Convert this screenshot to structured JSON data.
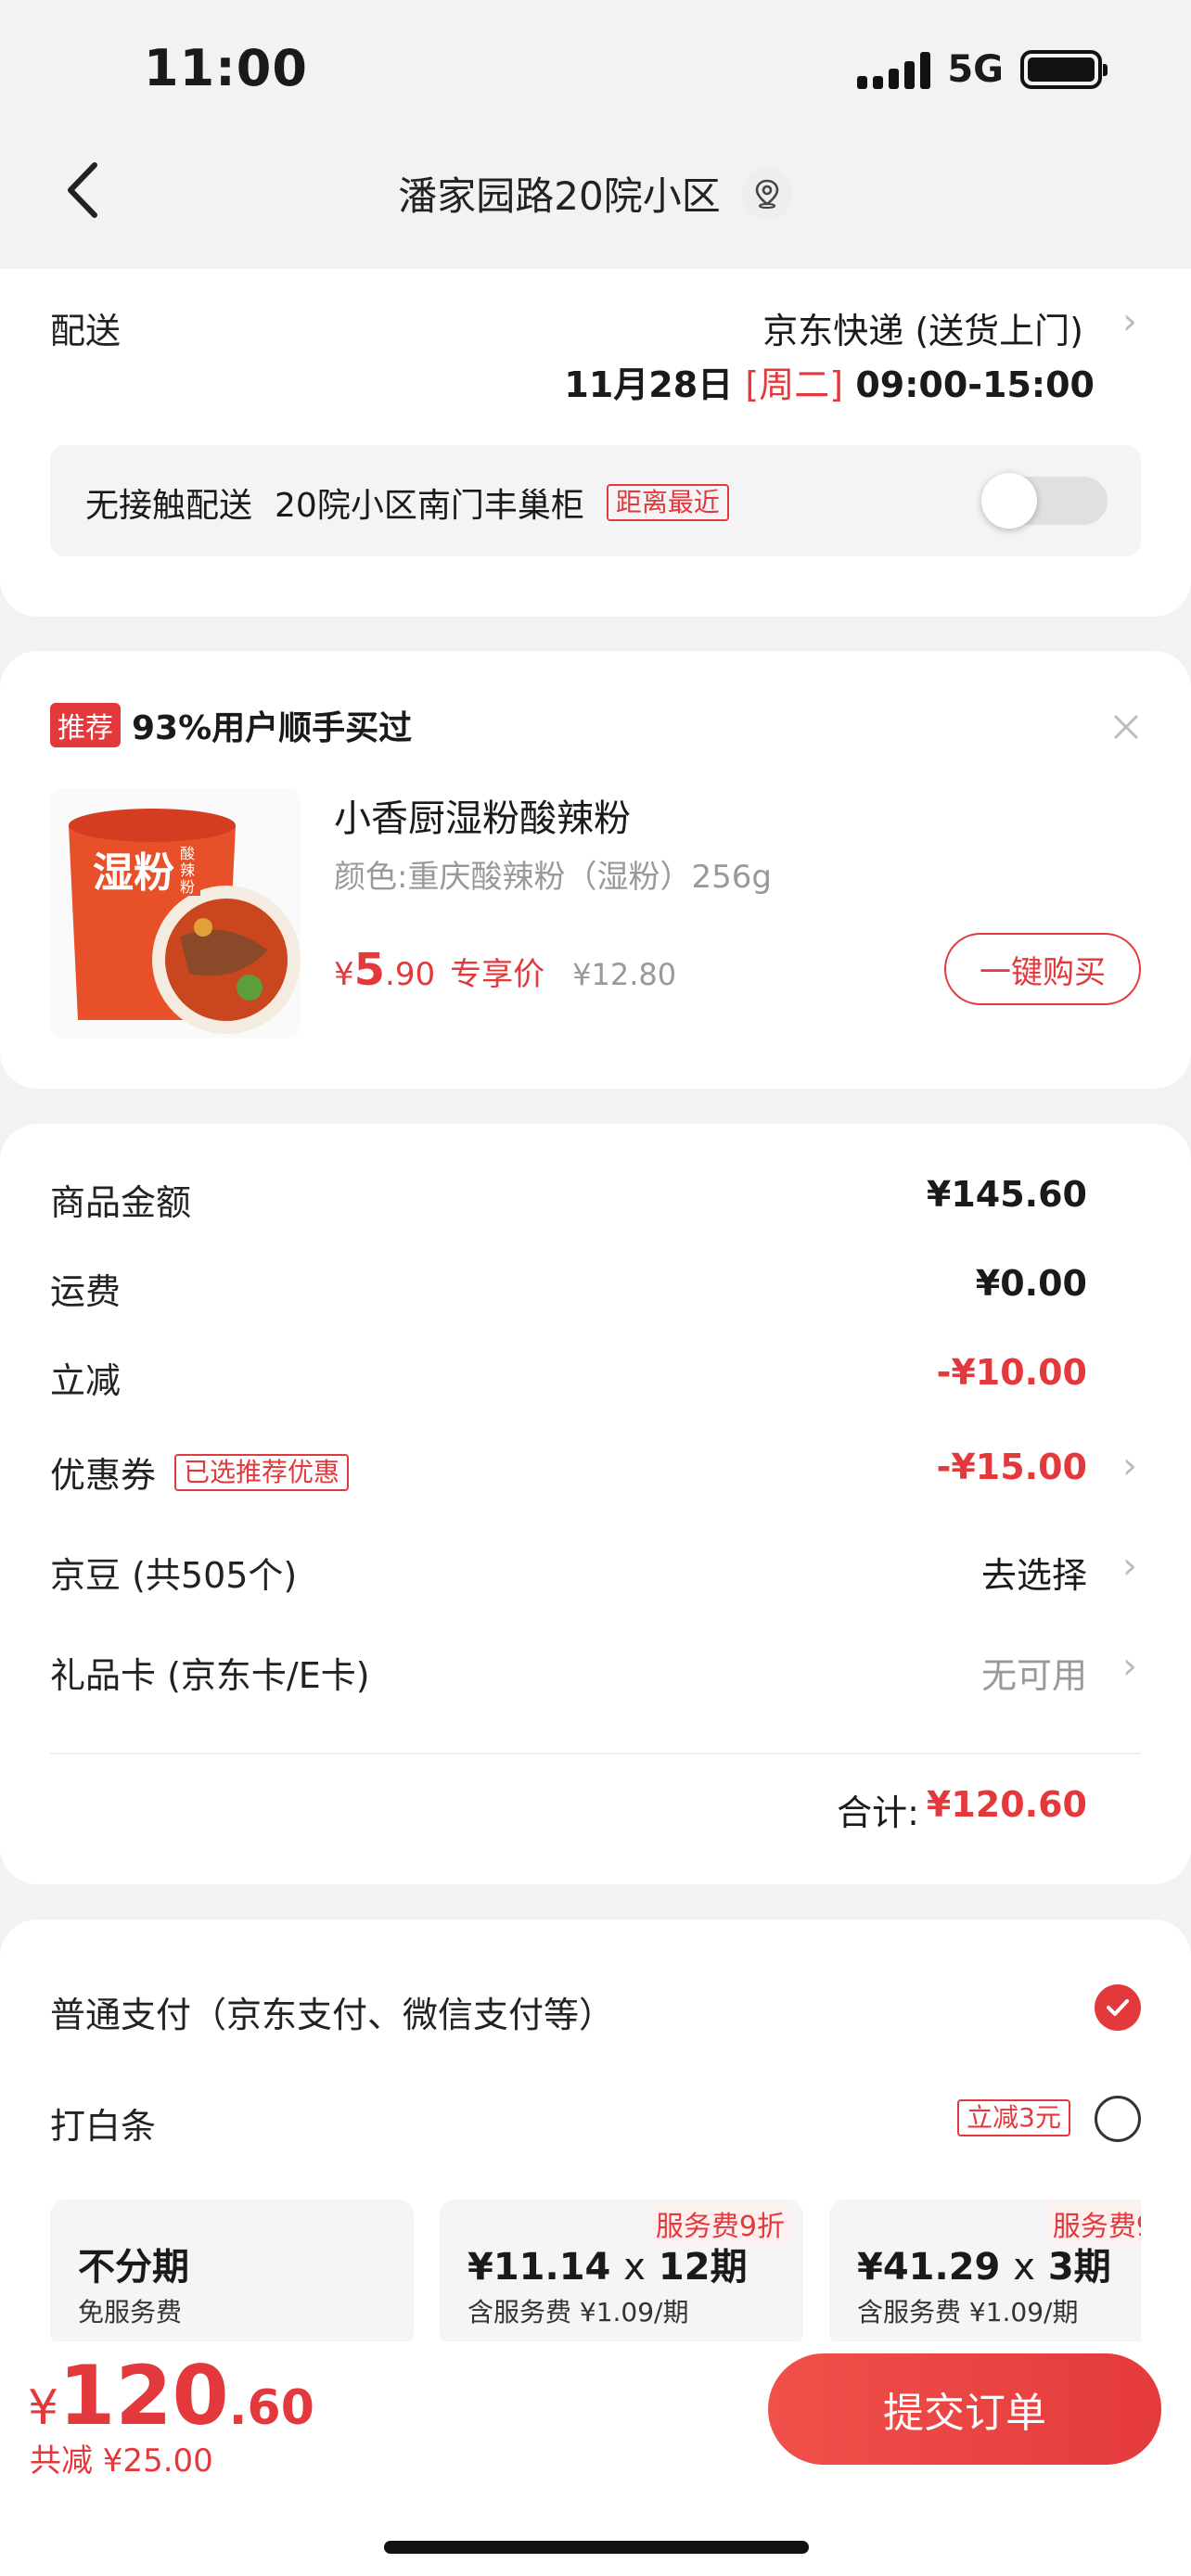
{
  "status_bar": {
    "time": "11:00",
    "network": "5G"
  },
  "nav": {
    "title": "潘家园路20院小区"
  },
  "delivery": {
    "label": "配送",
    "method": "京东快递 (送货上门)",
    "date": "11月28日",
    "weekday": "[周二]",
    "time_window": "09:00-15:00",
    "contactless_label": "无接触配送",
    "locker": "20院小区南门丰巢柜",
    "nearest_tag": "距离最近",
    "toggle_on": false
  },
  "recommend": {
    "badge": "推荐",
    "headline": "93%用户顺手买过",
    "product_name": "小香厨湿粉酸辣粉",
    "product_spec": "颜色:重庆酸辣粉（湿粉）256g",
    "price_symbol": "¥",
    "price_int": "5",
    "price_dec": ".90",
    "price_label": "专享价",
    "original_price": "¥12.80",
    "buy_button": "一键购买",
    "image_text_big": "湿粉",
    "image_text_small": "酸辣粉"
  },
  "summary": {
    "rows": [
      {
        "label": "商品金额",
        "value": "¥145.60"
      },
      {
        "label": "运费",
        "value": "¥0.00"
      },
      {
        "label": "立减",
        "value": "-¥10.00"
      },
      {
        "label": "优惠券",
        "tag": "已选推荐优惠",
        "value": "-¥15.00"
      },
      {
        "label": "京豆 (共505个)",
        "value": "去选择"
      },
      {
        "label": "礼品卡 (京东卡/E卡)",
        "value": "无可用"
      }
    ],
    "total_label": "合计:",
    "total_value": "¥120.60"
  },
  "payment": {
    "normal_label": "普通支付（京东支付、微信支付等）",
    "normal_selected": true,
    "baitiao_label": "打白条",
    "baitiao_tag": "立减3元",
    "baitiao_selected": false,
    "plans": [
      {
        "title": "不分期",
        "sub": "免服务费",
        "tag": ""
      },
      {
        "title_amount": "¥11.14",
        "title_x": "x",
        "title_period": "12期",
        "sub": "含服务费 ¥1.09/期",
        "tag": "服务费9折"
      },
      {
        "title_amount": "¥41.29",
        "title_x": "x",
        "title_period": "3期",
        "sub": "含服务费 ¥1.09/期",
        "tag": "服务费9"
      }
    ]
  },
  "bottom": {
    "price_symbol": "¥",
    "price_int": "120",
    "price_dec": ".60",
    "saved": "共减 ¥25.00",
    "submit": "提交订单"
  },
  "colors": {
    "accent": "#e4393c",
    "bg": "#f2f2f2"
  }
}
